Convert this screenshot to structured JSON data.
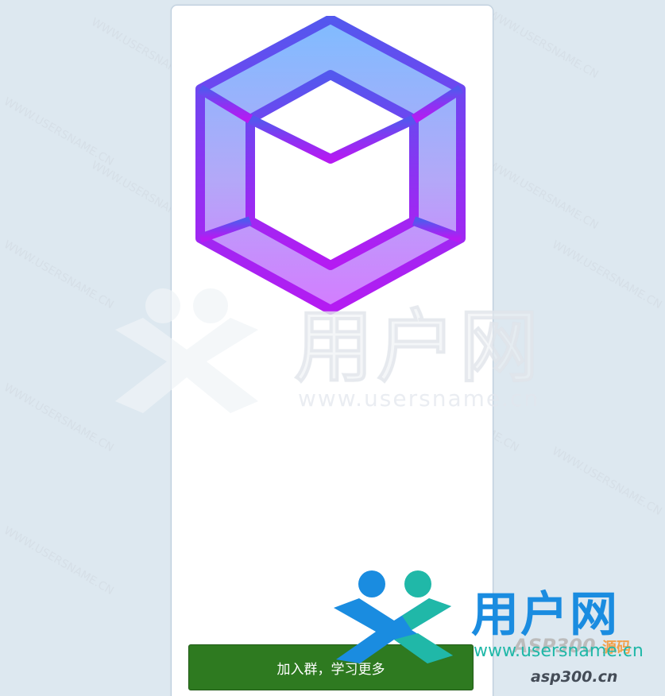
{
  "page": {
    "background": "#dde8f0",
    "card_background": "#ffffff"
  },
  "logo": {
    "icon": "webstorm-cube-icon",
    "gradient_top": "#7fb8ff",
    "gradient_bottom": "#c03cff",
    "stroke_top": "#5b55f0",
    "stroke_bottom": "#b020f0"
  },
  "join_button": {
    "label": "加入群，学习更多",
    "color": "#2e7a20"
  },
  "watermark": {
    "diagonal_text": "WWW.USERSNAME.CN",
    "center_cn": "用户网",
    "center_url": "www.usersname.cn"
  },
  "brand_overlay": {
    "cn": "用户网",
    "asp": "ASP300",
    "src_badge": "源码",
    "url": "www.usersname.cn",
    "asp_domain": "asp300.cn",
    "blue": "#1a8ce0",
    "teal": "#20b8a8"
  }
}
